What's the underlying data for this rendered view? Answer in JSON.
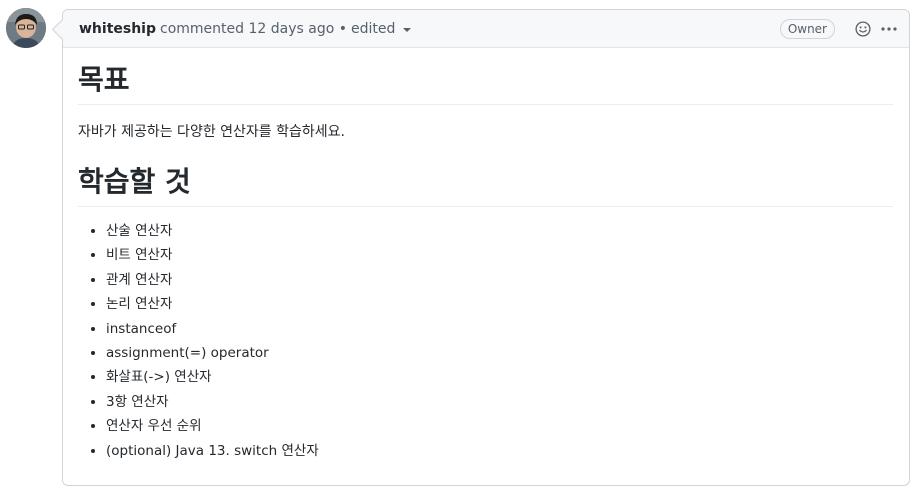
{
  "comment": {
    "author": "whiteship",
    "action": "commented",
    "time": "12 days ago",
    "separator": "•",
    "edited": "edited",
    "badge": "Owner"
  },
  "body": {
    "heading1": "목표",
    "paragraph": "자바가 제공하는 다양한 연산자를 학습하세요.",
    "heading2": "학습할 것",
    "items": [
      "산술 연산자",
      "비트 연산자",
      "관계 연산자",
      "논리 연산자",
      "instanceof",
      "assignment(=) operator",
      "화살표(->) 연산자",
      "3항 연산자",
      "연산자 우선 순위",
      "(optional) Java 13. switch 연산자"
    ]
  },
  "icons": {
    "avatar": "user-avatar",
    "reaction": "smiley-icon",
    "more": "kebab-horizontal-icon",
    "edited_menu": "triangle-down-icon"
  },
  "colors": {
    "border": "#d1d5da",
    "header_bg": "#f6f8fa",
    "text": "#24292e",
    "muted": "#586069"
  }
}
